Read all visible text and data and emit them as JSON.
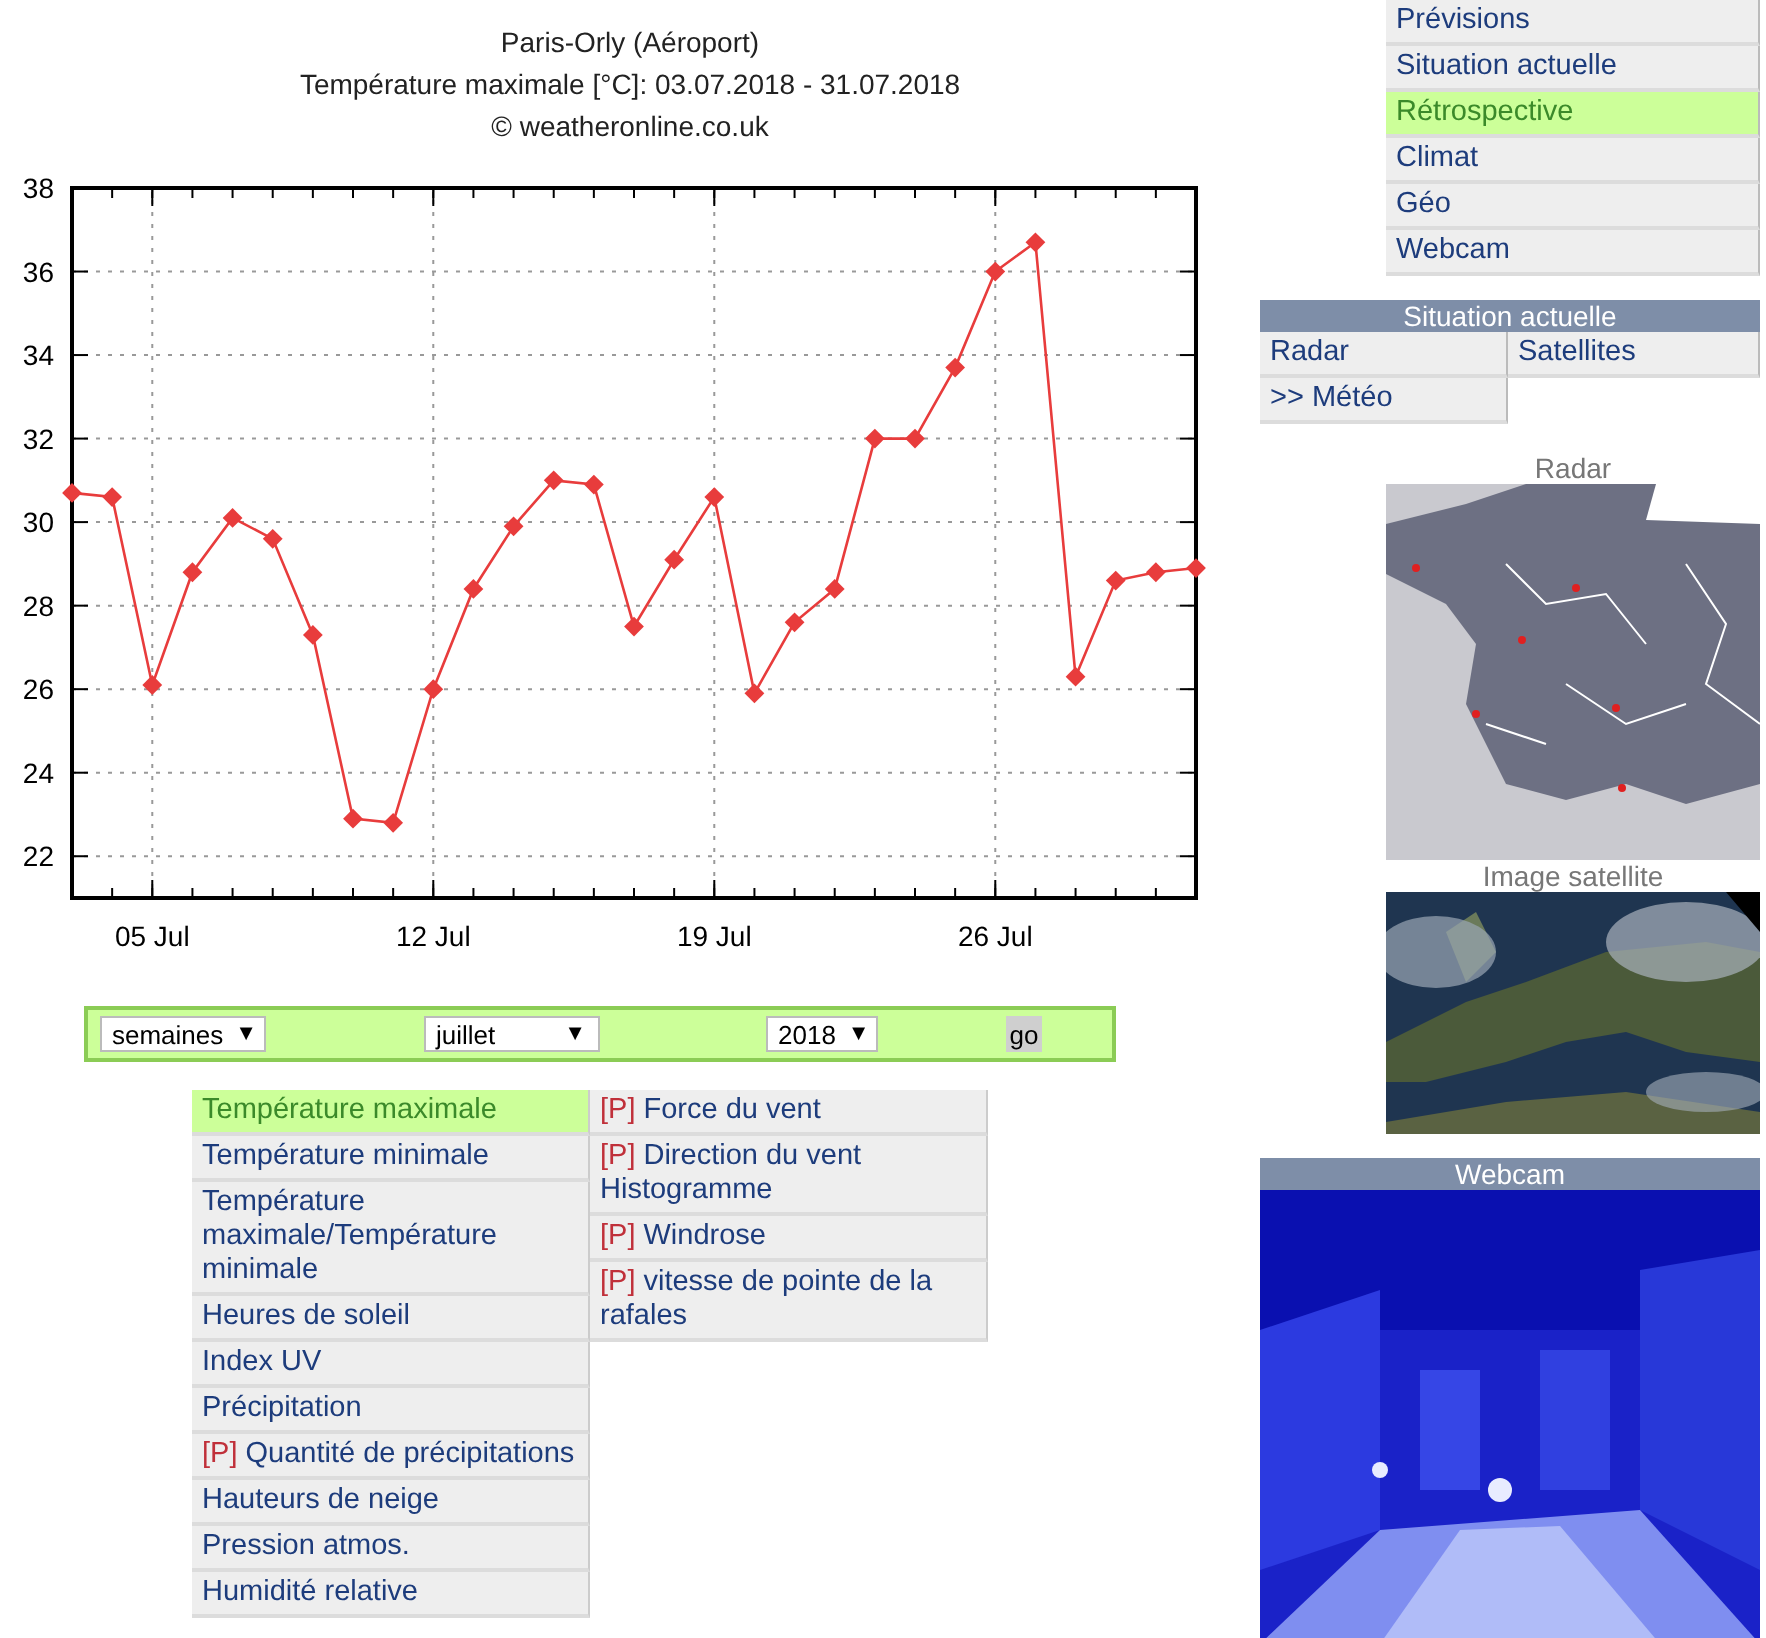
{
  "chart_header": {
    "station": "Paris-Orly (Aéroport)",
    "subtitle": "Température maximale [°C]: 03.07.2018 - 31.07.2018",
    "credit": "© weatheronline.co.uk"
  },
  "chart": {
    "chart_data": {
      "type": "line",
      "categories": [
        null,
        null,
        "05 Jul",
        null,
        null,
        null,
        null,
        null,
        null,
        "12 Jul",
        null,
        null,
        null,
        null,
        null,
        null,
        "19 Jul",
        null,
        null,
        null,
        null,
        null,
        null,
        "26 Jul",
        null,
        null,
        null,
        null,
        null
      ],
      "ylim": [
        21,
        38
      ],
      "yticks": [
        22,
        24,
        26,
        28,
        30,
        32,
        34,
        36,
        38
      ],
      "grid": true,
      "series": [
        {
          "color": "#e83c3c",
          "marker": "diamond",
          "values": [
            30.7,
            30.6,
            26.1,
            28.8,
            30.1,
            29.6,
            27.3,
            22.9,
            22.8,
            26.0,
            28.4,
            29.9,
            31.0,
            30.9,
            27.5,
            29.1,
            30.6,
            25.9,
            27.6,
            28.4,
            32.0,
            32.0,
            33.7,
            36.0,
            36.7,
            26.3,
            28.6,
            28.8,
            28.9
          ]
        }
      ]
    }
  },
  "period_bar": {
    "dropdowns": [
      {
        "value": "semaines",
        "caret": "▼"
      },
      {
        "value": "juillet",
        "caret": "▼"
      },
      {
        "value": "2018",
        "caret": "▼"
      }
    ],
    "go_button": "go"
  },
  "parameters": {
    "columns": [
      [
        {
          "label": "Température maximale",
          "selected": true
        },
        {
          "label": "Température minimale",
          "selected": false
        },
        {
          "label": "Température maximale/Température minimale",
          "selected": false
        },
        {
          "label": "Heures de soleil",
          "selected": false
        },
        {
          "label": "Index UV",
          "selected": false
        },
        {
          "label": "Précipitation",
          "selected": false
        },
        {
          "prefix": "[P]",
          "label": "Quantité de précipitations",
          "selected": false
        },
        {
          "label": "Hauteurs de neige",
          "selected": false
        },
        {
          "label": "Pression atmos.",
          "selected": false
        },
        {
          "label": "Humidité relative",
          "selected": false
        }
      ],
      [
        {
          "prefix": "[P]",
          "label": "Force du vent",
          "selected": false
        },
        {
          "prefix": "[P]",
          "label": "Direction du vent Histogramme",
          "selected": false
        },
        {
          "prefix": "[P]",
          "label": "Windrose",
          "selected": false
        },
        {
          "prefix": "[P]",
          "label": "vitesse de pointe de la rafales",
          "selected": false
        }
      ]
    ]
  },
  "nav_menu": [
    {
      "label": "Prévisions",
      "selected": false
    },
    {
      "label": "Situation actuelle",
      "selected": false
    },
    {
      "label": "Rétrospective",
      "selected": true
    },
    {
      "label": "Climat",
      "selected": false
    },
    {
      "label": "Géo",
      "selected": false
    },
    {
      "label": "Webcam",
      "selected": false
    }
  ],
  "current_panel": {
    "title": "Situation actuelle",
    "links": [
      "Radar",
      "Satellites",
      ">> Météo"
    ]
  },
  "radar": {
    "label": "Radar",
    "kind": "picture"
  },
  "satellite": {
    "label": "Image satellite",
    "kind": "picture"
  },
  "webcam": {
    "title": "Webcam",
    "kind": "picture"
  }
}
